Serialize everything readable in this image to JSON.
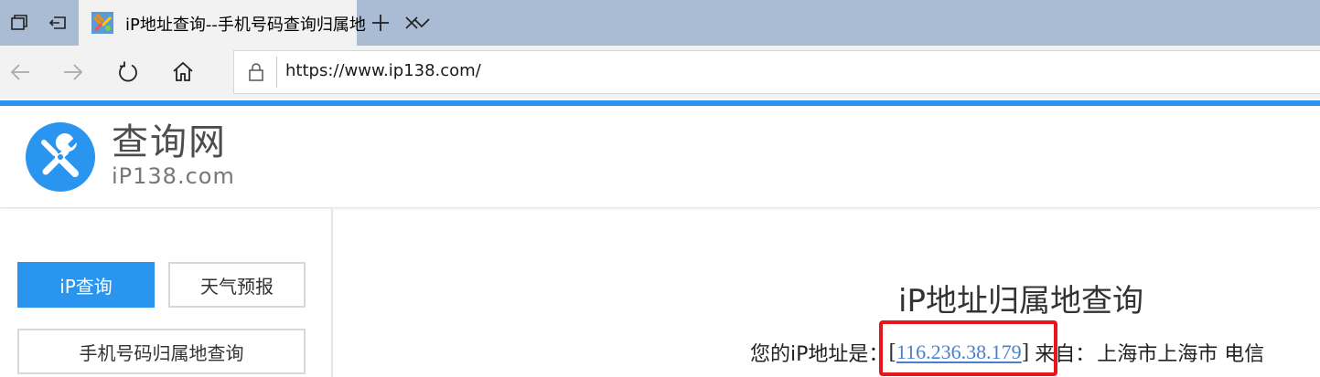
{
  "browser": {
    "tab": {
      "title": "iP地址查询--手机号码查询归属地"
    },
    "address_bar": {
      "url": "https://www.ip138.com/"
    }
  },
  "site": {
    "logo": {
      "name": "查询网",
      "domain": "iP138.com"
    },
    "sidebar": {
      "ip_query": "iP查询",
      "weather": "天气预报",
      "phone_lookup": "手机号码归属地查询"
    },
    "main": {
      "title": "iP地址归属地查询",
      "ip_label": "您的iP地址是：",
      "bracket_open": "[",
      "ip_address": "116.236.38.179",
      "bracket_close": "]",
      "from_label": "来自：",
      "location": "上海市上海市 电信"
    }
  },
  "colors": {
    "accent": "#2a95ef",
    "tabstrip": "#a9bcd3",
    "highlight": "#e8151b",
    "link": "#4a7fc9"
  },
  "icons": {
    "tab_actions": [
      "tab-set-aside-icon",
      "restore-tabs-icon"
    ],
    "nav": [
      "back-arrow-icon",
      "forward-arrow-icon",
      "refresh-icon",
      "home-icon"
    ],
    "address": "lock-icon",
    "tab": [
      "favicon-icon",
      "close-icon"
    ],
    "tabstrip": [
      "plus-icon",
      "chevron-down-icon"
    ]
  }
}
